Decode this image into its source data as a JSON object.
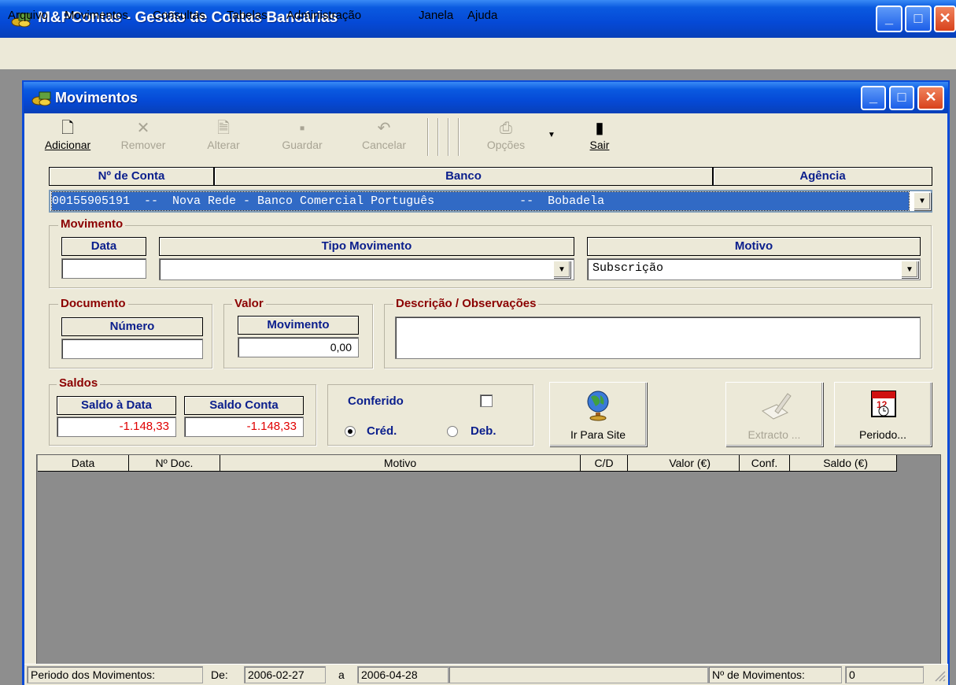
{
  "app": {
    "title": "M&PContas - Gestão de Contas Bancárias",
    "menu": [
      "Arquivo",
      "Movimentos",
      "Consultas",
      "Tabelas",
      "Administração",
      "Janela",
      "Ajuda"
    ]
  },
  "window": {
    "title": "Movimentos"
  },
  "toolbar": {
    "add": "Adicionar",
    "remove": "Remover",
    "edit": "Alterar",
    "save": "Guardar",
    "cancel": "Cancelar",
    "options": "Opções",
    "exit": "Sair"
  },
  "account": {
    "headers": {
      "number": "Nº de Conta",
      "bank": "Banco",
      "branch": "Agência"
    },
    "selected": "00155905191  --  Nova Rede - Banco Comercial Português            --  Bobadela"
  },
  "movement": {
    "group_label": "Movimento",
    "date_header": "Data",
    "type_header": "Tipo Movimento",
    "reason_header": "Motivo",
    "date_value": "",
    "type_value": "",
    "reason_value": "Subscrição"
  },
  "document": {
    "group_label": "Documento",
    "number_header": "Número",
    "number_value": ""
  },
  "value": {
    "group_label": "Valor",
    "movement_header": "Movimento",
    "movement_value": "0,00"
  },
  "description": {
    "group_label": "Descrição / Observações",
    "value": ""
  },
  "balances": {
    "group_label": "Saldos",
    "date_header": "Saldo à Data",
    "account_header": "Saldo Conta",
    "date_value": "-1.148,33",
    "account_value": "-1.148,33"
  },
  "checked": {
    "label": "Conferido",
    "checked": false,
    "credit_label": "Créd.",
    "debit_label": "Deb.",
    "selected": "credit"
  },
  "buttons": {
    "site": "Ir Para Site",
    "statement": "Extracto ...",
    "period": "Periodo..."
  },
  "grid": {
    "columns": [
      "Data",
      "Nº Doc.",
      "Motivo",
      "C/D",
      "Valor (€)",
      "Conf.",
      "Saldo (€)"
    ],
    "rows": []
  },
  "status": {
    "period_label": "Periodo dos Movimentos:",
    "from_label": "De:",
    "from_value": "2006-02-27",
    "to_label": "a",
    "to_value": "2006-04-28",
    "count_label": "Nº de Movimentos:",
    "count_value": "0"
  },
  "colors": {
    "titlebar": "#0549d6",
    "selection": "#316ac5",
    "header_text": "#0a1e8c",
    "group_label": "#8b0000",
    "negative": "#e00000"
  }
}
